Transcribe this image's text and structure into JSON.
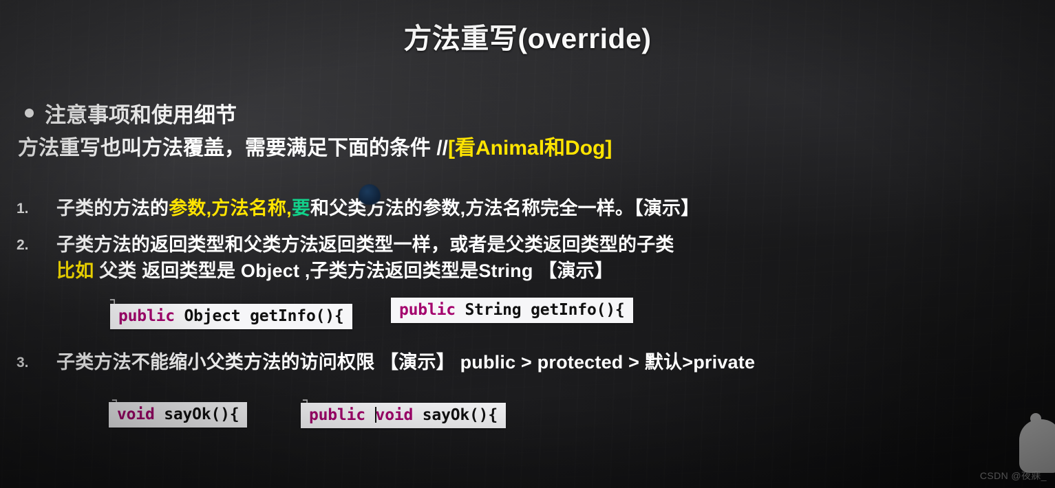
{
  "slide": {
    "title": "方法重写(override)",
    "bullet_heading": "注意事项和使用细节",
    "subtitle": {
      "plain": "方法重写也叫方法覆盖，需要满足下面的条件 //",
      "highlight": "[看Animal和Dog]"
    },
    "items": [
      {
        "number": "1.",
        "segments": [
          {
            "text": "子类的方法的",
            "color": "white"
          },
          {
            "text": "参数,方法名称",
            "color": "#ffe400"
          },
          {
            "text": ",",
            "color": "white"
          },
          {
            "text": "要",
            "color": "#12d18a"
          },
          {
            "text": "和父类方法的参数,方法名称完全一样。【演示】",
            "color": "white"
          }
        ]
      },
      {
        "number": "2.",
        "segments": [
          {
            "text": "子类方法的返回类型和父类方法返回类型一样，或者是父类返回类型的子类",
            "color": "white"
          }
        ],
        "second_line": [
          {
            "text": "比如",
            "color": "#ffe400"
          },
          {
            "text": " 父类 返回类型是 Object ,子类方法返回类型是String 【演示】",
            "color": "white"
          }
        ]
      },
      {
        "number": "3.",
        "segments": [
          {
            "text": "子类方法不能缩小父类方法的访问权限 【演示】 public > protected > 默认>private",
            "color": "white"
          }
        ]
      }
    ],
    "code_snippets": [
      {
        "name": "parent-getinfo",
        "keyword": "public",
        "rest": " Object getInfo(){",
        "has_cursor": false
      },
      {
        "name": "child-getinfo",
        "keyword": "public",
        "rest": " String getInfo(){",
        "has_cursor": false
      },
      {
        "name": "parent-sayok",
        "keyword": "void",
        "rest": " sayOk(){",
        "has_cursor": false
      },
      {
        "name": "child-sayok",
        "keyword": "public",
        "keyword2": "void",
        "rest": " sayOk(){",
        "has_cursor": true
      }
    ],
    "code_ghost_brace": "┐",
    "watermark": "CSDN @夜寐_",
    "colors": {
      "background_dark": "#1d1d1f",
      "text_white": "#ffffff",
      "highlight_yellow": "#ffe400",
      "highlight_green": "#12d18a",
      "code_background": "#f6f6f8",
      "code_keyword": "#a3006c",
      "code_text": "#101010"
    }
  }
}
